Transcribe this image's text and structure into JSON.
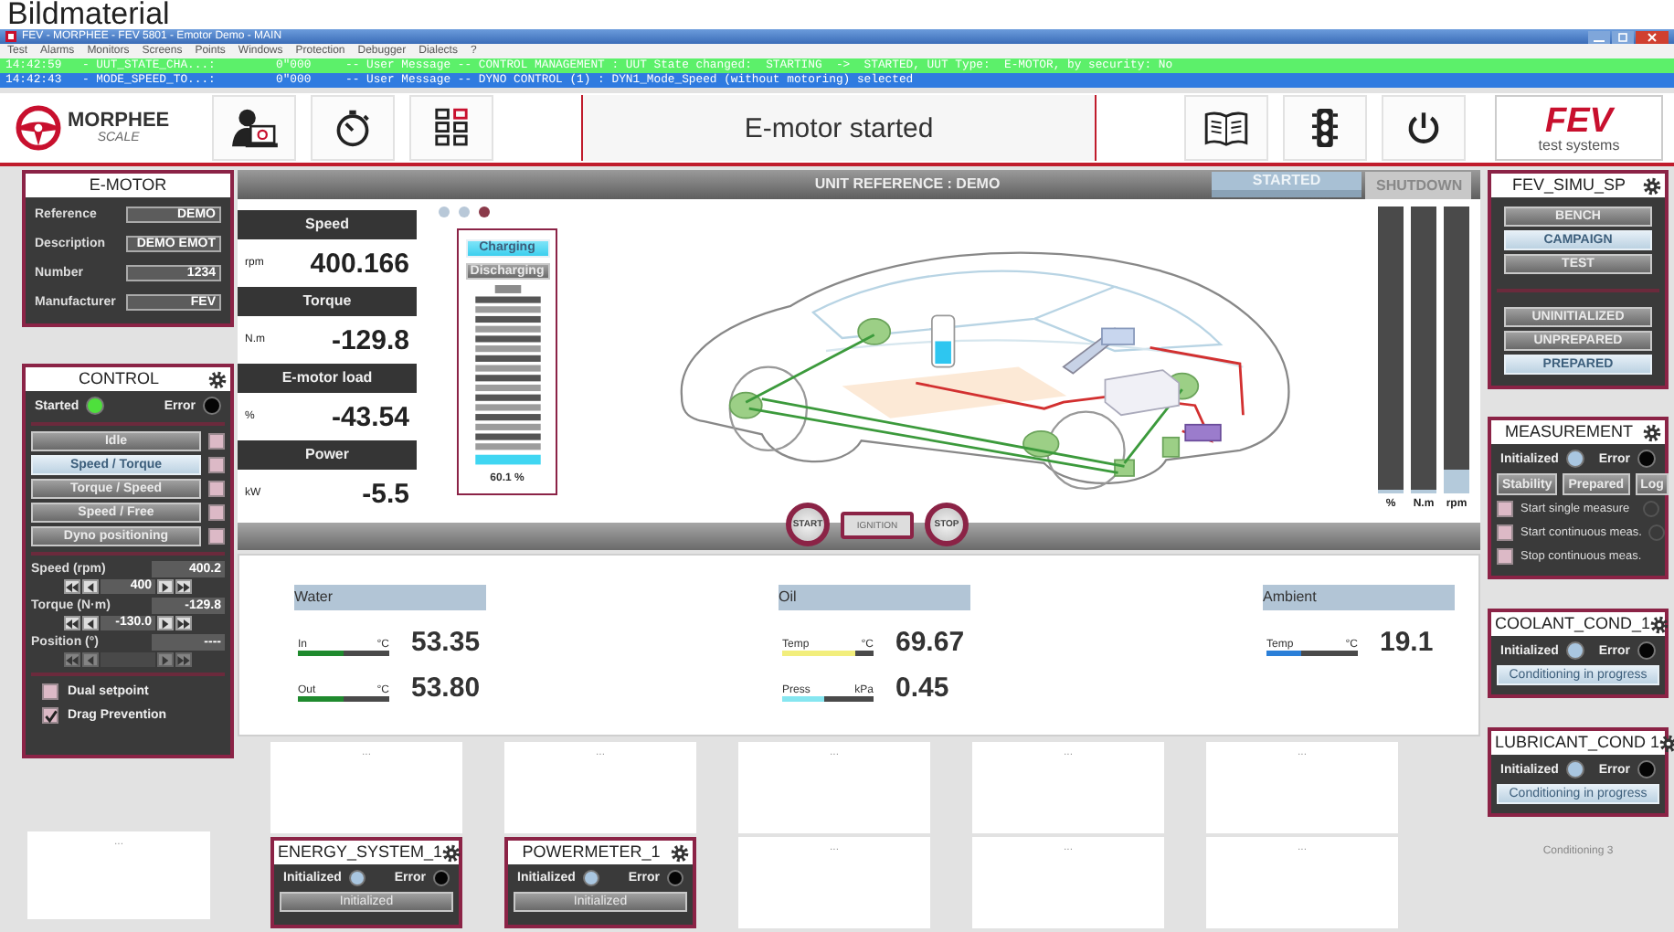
{
  "caption": "Bildmaterial",
  "window": {
    "title": "FEV - MORPHEE - FEV 5801 - Emotor Demo - MAIN"
  },
  "menu": [
    "Test",
    "Alarms",
    "Monitors",
    "Screens",
    "Points",
    "Windows",
    "Protection",
    "Debugger",
    "Dialects",
    "?"
  ],
  "messages": [
    {
      "time": "14:42:59",
      "source": "- UUT_STATE_CHA...:",
      "code": "0\"000",
      "text": "-- User Message -- CONTROL MANAGEMENT : UUT State changed:  STARTING  ->  STARTED, UUT Type:  E-MOTOR, by security: No",
      "color": "#5cf06a"
    },
    {
      "time": "14:42:43",
      "source": "- MODE_SPEED_TO...:",
      "code": "0\"000",
      "text": "-- User Message -- DYNO CONTROL (1) : DYN1_Mode_Speed (without motoring) selected",
      "color": "#2f7be0"
    }
  ],
  "toolbar": {
    "logo": "MORPHEE",
    "logo_sub": "SCALE",
    "status": "E-motor started",
    "brand": "FEV",
    "brand_sub": "test systems"
  },
  "emotor": {
    "title": "E-MOTOR",
    "gear": false,
    "fields": [
      {
        "label": "Reference",
        "value": "DEMO"
      },
      {
        "label": "Description",
        "value": "DEMO EMOT"
      },
      {
        "label": "Number",
        "value": "1234"
      },
      {
        "label": "Manufacturer",
        "value": "FEV"
      }
    ]
  },
  "control": {
    "title": "CONTROL",
    "gear": true,
    "indicators": [
      {
        "label": "Started",
        "color": "#4ee03c"
      },
      {
        "label": "Error",
        "color": "#050505"
      }
    ],
    "modes": [
      {
        "label": "Idle",
        "selected": false,
        "checked": false
      },
      {
        "label": "Speed / Torque",
        "selected": true,
        "checked": false
      },
      {
        "label": "Torque / Speed",
        "selected": false,
        "checked": false
      },
      {
        "label": "Speed / Free",
        "selected": false,
        "checked": false
      },
      {
        "label": "Dyno positioning",
        "selected": false,
        "checked": false
      }
    ],
    "setpoints": [
      {
        "label": "Speed (rpm)",
        "reading": "400.2",
        "value": "400",
        "disabled": false
      },
      {
        "label": "Torque (N·m)",
        "reading": "-129.8",
        "value": "-130.0",
        "disabled": false
      },
      {
        "label": "Position (°)",
        "reading": "----",
        "disabled": true
      }
    ],
    "options": [
      {
        "label": "Dual setpoint",
        "checked": false
      },
      {
        "label": "Drag Prevention",
        "checked": true
      }
    ]
  },
  "side_tile": {
    "text": "..."
  },
  "unit": {
    "title": "UNIT REFERENCE : DEMO",
    "state": "STARTED",
    "shutdown": "SHUTDOWN",
    "pages": [
      {
        "selected": false
      },
      {
        "selected": false
      },
      {
        "selected": true
      }
    ],
    "readings": [
      {
        "name": "Speed",
        "unit": "rpm",
        "value": "400.166"
      },
      {
        "name": "Torque",
        "unit": "N.m",
        "value": "-129.8"
      },
      {
        "name": "E-motor load",
        "unit": "%",
        "value": "-43.54"
      },
      {
        "name": "Power",
        "unit": "kW",
        "value": "-5.5"
      }
    ],
    "battery": {
      "modes": [
        {
          "label": "Charging",
          "selected": true
        },
        {
          "label": "Discharging",
          "selected": false
        }
      ],
      "reading": "60.1 %"
    },
    "bars": [
      {
        "unit": "%",
        "level": 0
      },
      {
        "unit": "N.m",
        "level": 0
      },
      {
        "unit": "rpm",
        "level": 0.07
      }
    ],
    "buttons": [
      {
        "label": "START",
        "kind": "round"
      },
      {
        "label": "IGNITION",
        "kind": "rect"
      },
      {
        "label": "STOP",
        "kind": "round"
      }
    ]
  },
  "fluids": [
    {
      "name": "Water",
      "sensors": [
        {
          "label": "In",
          "unit": "°C",
          "value": "53.35",
          "level": 0.5,
          "color": "#1f8a2e"
        },
        {
          "label": "Out",
          "unit": "°C",
          "value": "53.80",
          "level": 0.5,
          "color": "#1f8a2e"
        }
      ]
    },
    {
      "name": "Oil",
      "sensors": [
        {
          "label": "Temp",
          "unit": "°C",
          "value": "69.67",
          "level": 0.8,
          "color": "#f2ee7c"
        },
        {
          "label": "Press",
          "unit": "kPa",
          "value": "0.45",
          "level": 0.45,
          "color": "#86e6f0"
        }
      ]
    },
    {
      "name": "Ambient",
      "sensors": [
        {
          "label": "Temp",
          "unit": "°C",
          "value": "19.1",
          "level": 0.38,
          "color": "#2b7fd8"
        }
      ]
    }
  ],
  "tiles": [
    {
      "kind": "empty",
      "text": "..."
    },
    {
      "kind": "empty",
      "text": "..."
    },
    {
      "kind": "empty",
      "text": "..."
    },
    {
      "kind": "empty",
      "text": "..."
    },
    {
      "kind": "empty",
      "text": "..."
    },
    {
      "kind": "device",
      "title": "ENERGY_SYSTEM_1",
      "gear": true,
      "indicators": [
        {
          "label": "Initialized",
          "color": "#a9c6e0"
        },
        {
          "label": "Error",
          "color": "#050505"
        }
      ],
      "status": "Initialized"
    },
    {
      "kind": "device",
      "title": "POWERMETER_1",
      "gear": true,
      "indicators": [
        {
          "label": "Initialized",
          "color": "#a9c6e0"
        },
        {
          "label": "Error",
          "color": "#050505"
        }
      ],
      "status": "Initialized"
    },
    {
      "kind": "empty",
      "text": "..."
    },
    {
      "kind": "empty",
      "text": "..."
    },
    {
      "kind": "empty",
      "text": "..."
    }
  ],
  "simu": {
    "title": "FEV_SIMU_SP",
    "gear": true,
    "groups": [
      {
        "buttons": [
          {
            "label": "BENCH",
            "selected": false
          },
          {
            "label": "CAMPAIGN",
            "selected": true
          },
          {
            "label": "TEST",
            "selected": false
          }
        ]
      },
      {
        "buttons": [
          {
            "label": "UNINITIALIZED",
            "selected": false
          },
          {
            "label": "UNPREPARED",
            "selected": false
          },
          {
            "label": "PREPARED",
            "selected": true
          }
        ]
      }
    ]
  },
  "measurement": {
    "title": "MEASUREMENT",
    "gear": true,
    "indicators": [
      {
        "label": "Initialized",
        "color": "#a9c6e0"
      },
      {
        "label": "Error",
        "color": "#050505"
      }
    ],
    "buttons": [
      "Stability",
      "Prepared",
      "Log"
    ],
    "actions": [
      {
        "label": "Start single measure",
        "checked": false,
        "kind": "lamp"
      },
      {
        "label": "Start continuous meas.",
        "checked": false,
        "kind": "lamp"
      },
      {
        "label": "Stop continuous meas.",
        "checked": false,
        "kind": "plain"
      }
    ]
  },
  "conditioners": [
    {
      "title": "COOLANT_COND_1",
      "gear": true,
      "indicators": [
        {
          "label": "Initialized",
          "color": "#a9c6e0"
        },
        {
          "label": "Error",
          "color": "#050505"
        }
      ],
      "status": "Conditioning in progress"
    },
    {
      "title": "LUBRICANT_COND 1",
      "gear": true,
      "indicators": [
        {
          "label": "Initialized",
          "color": "#a9c6e0"
        },
        {
          "label": "Error",
          "color": "#050505"
        }
      ],
      "status": "Conditioning in progress"
    }
  ],
  "footer_note": "Conditioning 3"
}
